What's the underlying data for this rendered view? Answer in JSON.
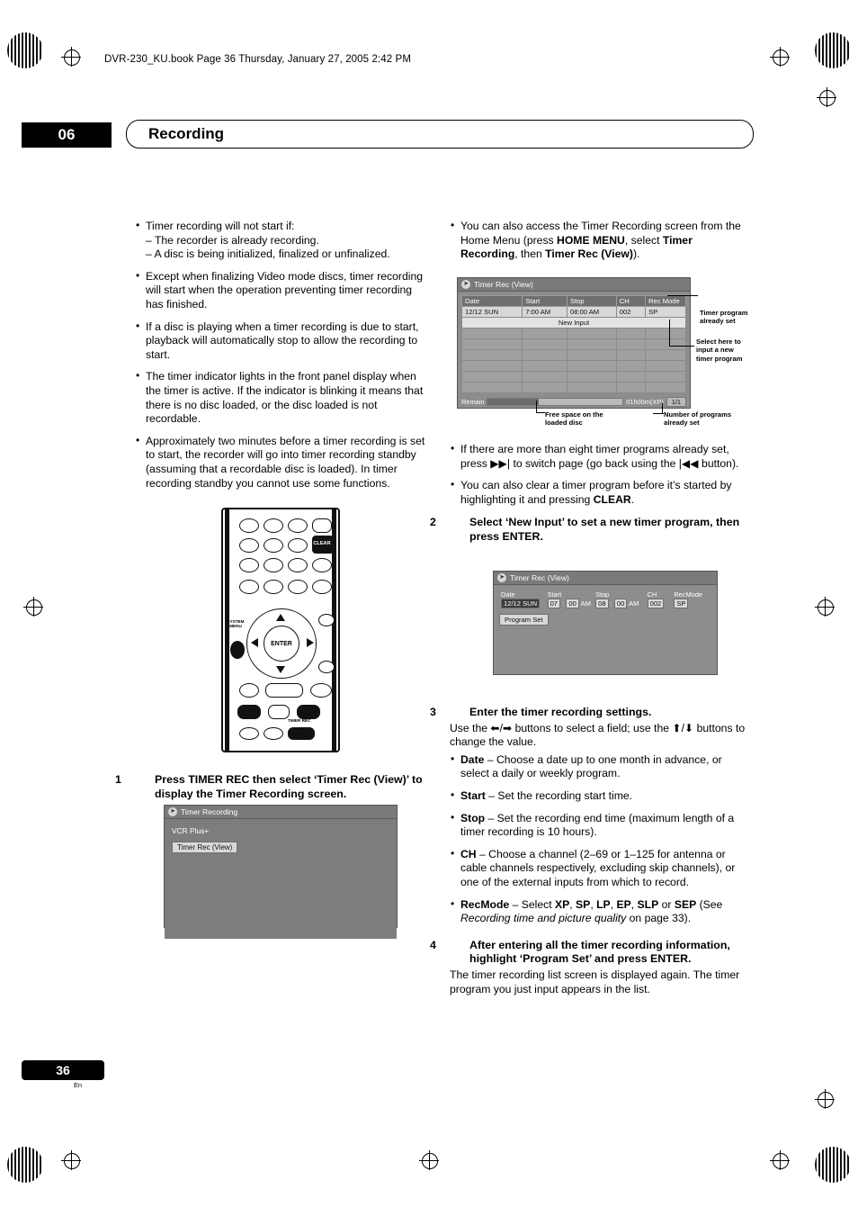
{
  "header": {
    "book_line": "DVR-230_KU.book  Page 36  Thursday, January 27, 2005  2:42 PM",
    "chapter_number": "06",
    "chapter_title": "Recording"
  },
  "footer": {
    "page_number": "36",
    "language": "En"
  },
  "left_column": {
    "bullets": [
      {
        "text": "Timer recording will not start if:",
        "sublines": [
          "– The recorder is already recording.",
          "– A disc is being initialized, finalized or unfinalized."
        ]
      },
      {
        "text": "Except when finalizing Video mode discs, timer recording will start when the operation preventing timer recording has finished.",
        "sublines": []
      },
      {
        "text": "If a disc is playing when a timer recording is due to start, playback will automatically stop to allow the recording to start.",
        "sublines": []
      },
      {
        "text": "The timer indicator lights in the front panel display when the timer is active. If the indicator is blinking it means that there is no disc loaded, or the disc loaded is not recordable.",
        "sublines": []
      },
      {
        "text": "Approximately two minutes before a timer recording is set to start, the recorder will go into timer recording standby (assuming that a recordable disc is loaded). In timer recording standby you cannot use some functions.",
        "sublines": []
      }
    ],
    "step1": {
      "number": "1",
      "text": "Press TIMER REC then select ‘Timer Rec (View)’ to display the Timer Recording screen."
    }
  },
  "remote": {
    "clear_label": "CLEAR",
    "enter_label": "ENTER",
    "system_menu_label": "SYSTEM MENU",
    "timer_rec_label": "TIMER REC"
  },
  "osd_home": {
    "title": "Timer Recording",
    "vcr_plus": "VCR Plus+",
    "timer_rec_view": "Timer Rec (View)"
  },
  "osd_view": {
    "title": "Timer Rec (View)",
    "columns": [
      "Date",
      "Start",
      "Stop",
      "CH",
      "Rec Mode"
    ],
    "rows": [
      [
        "12/12 SUN",
        "7:00 AM",
        "08:00 AM",
        "002",
        "SP"
      ]
    ],
    "new_input": "New Input",
    "remain_label": "Remain",
    "remain_value": "01h00m(XP)",
    "program_count": "1/1",
    "callouts": {
      "already_set": "Timer program already set",
      "select_here": "Select here to input a new timer program",
      "free_space": "Free space on the loaded disc",
      "num_programs": "Number of programs already set"
    }
  },
  "osd_edit": {
    "title": "Timer Rec (View)",
    "columns": [
      "Date",
      "Start",
      "Stop",
      "CH",
      "RecMode"
    ],
    "date": "12/12 SUN",
    "start_h": "07",
    "start_m": "00",
    "start_ampm": "AM",
    "stop_h": "08",
    "stop_m": "00",
    "stop_ampm": "AM",
    "ch": "002",
    "recmode": "SP",
    "program_set": "Program Set"
  },
  "right_column": {
    "bullets_top": [
      "You can also access the Timer Recording screen from the Home Menu (press HOME MENU, select Timer Recording, then Timer Rec (View))."
    ],
    "bullets_mid": [
      "If there are more than eight timer programs already set, press ▶▶| to switch page (go back using the |◀◀ button).",
      "You can also clear a timer program before it’s started by highlighting it and pressing CLEAR."
    ],
    "step2": {
      "number": "2",
      "text": "Select ‘New Input’ to set a new timer program, then press ENTER."
    },
    "step3": {
      "number": "3",
      "text": "Enter the timer recording settings.",
      "intro": "Use the ⬅/➡ buttons to select a field; use the ⬆/⬇ buttons to change the value.",
      "items": [
        {
          "term": "Date",
          "desc": "– Choose a date up to one month in advance, or select a daily or weekly program."
        },
        {
          "term": "Start",
          "desc": "– Set the recording start time."
        },
        {
          "term": "Stop",
          "desc": "– Set the recording end time (maximum length of a timer recording is 10 hours)."
        },
        {
          "term": "CH",
          "desc": "– Choose a channel (2–69 or 1–125 for antenna or cable channels respectively, excluding skip channels), or one of the external inputs from which to record."
        },
        {
          "term": "RecMode",
          "desc": "– Select XP, SP, LP, EP, SLP or SEP (See Recording time and picture quality on page 33)."
        }
      ]
    },
    "step4": {
      "number": "4",
      "text": "After entering all the timer recording information, highlight ‘Program Set’ and press ENTER.",
      "body": "The timer recording list screen is displayed again. The timer program you just input appears in the list."
    }
  }
}
